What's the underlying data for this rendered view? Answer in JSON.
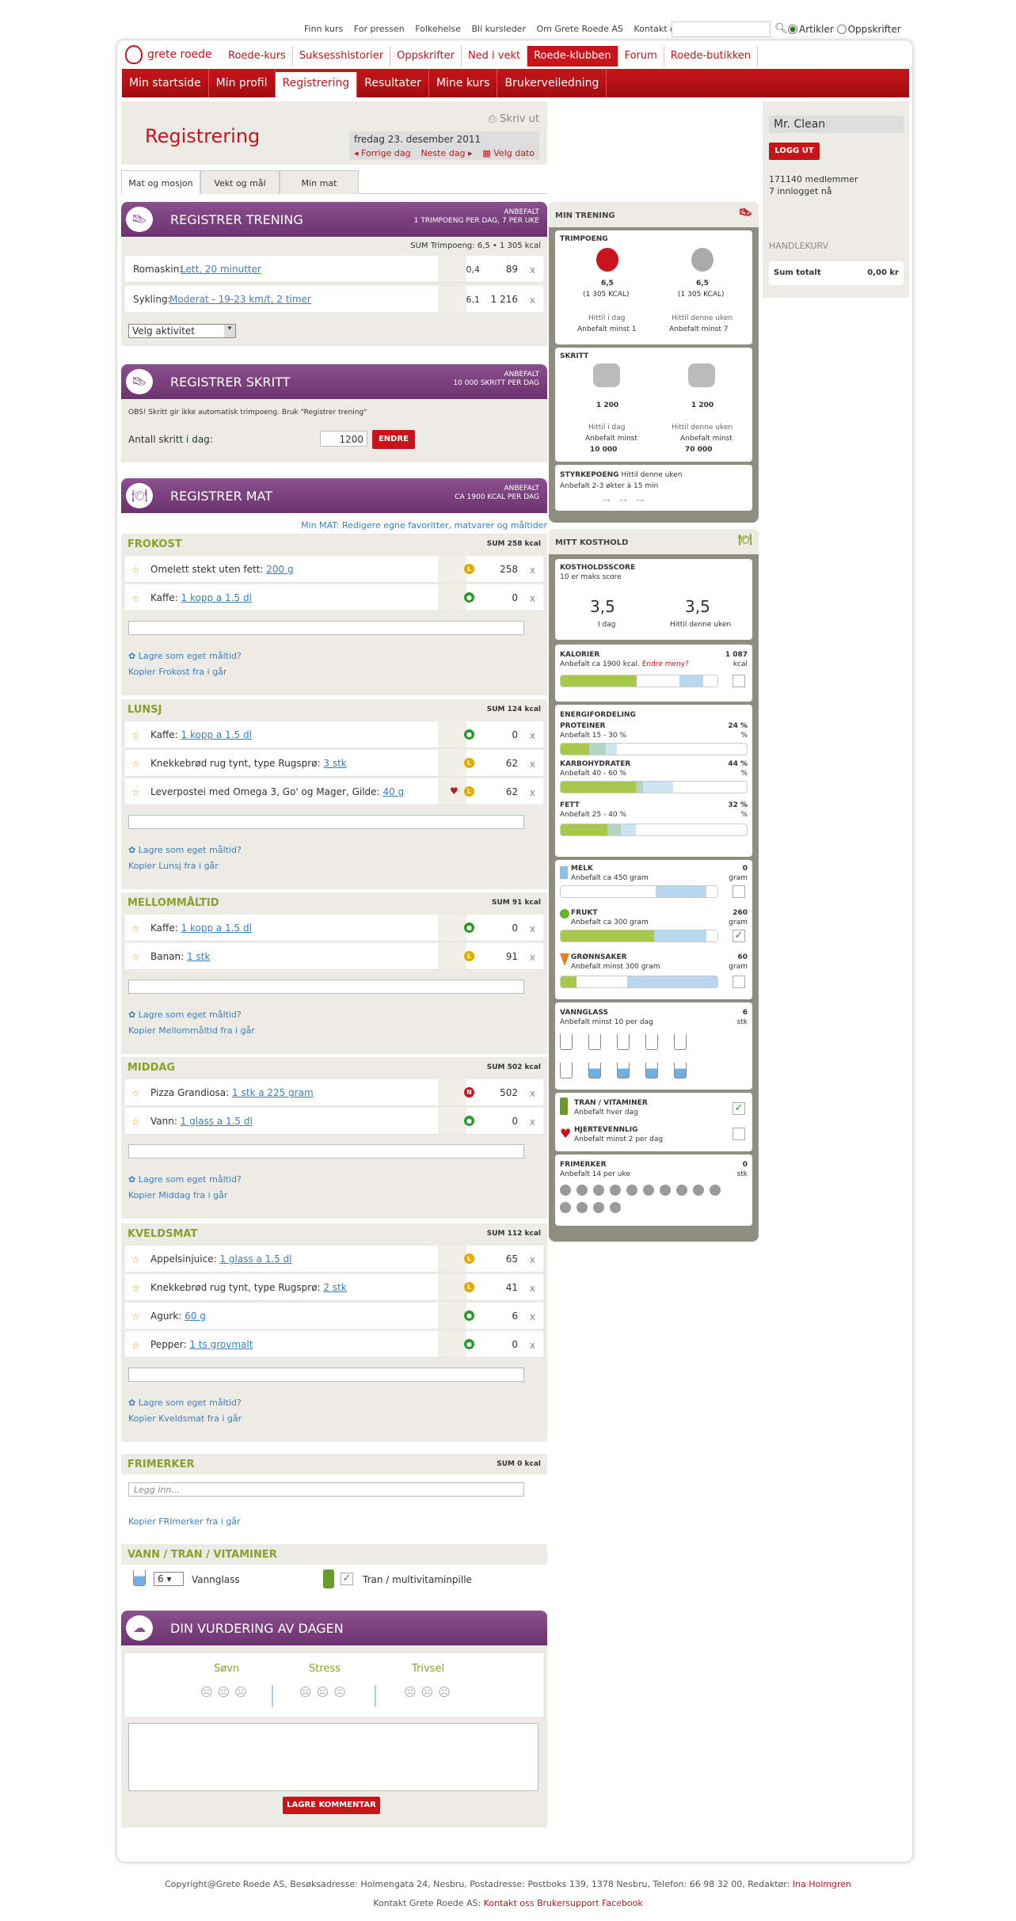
{
  "toplinks": [
    "Finn kurs",
    "For pressen",
    "Folkehelse",
    "Bli kursleder",
    "Om Grete Roede AS",
    "Kontakt oss"
  ],
  "search": {
    "opt1": "Artikler",
    "opt2": "Oppskrifter"
  },
  "logo": "grete roede",
  "nav1": [
    "Roede-kurs",
    "Suksesshistorier",
    "Oppskrifter",
    "Ned i vekt",
    "Roede-klubben",
    "Forum",
    "Roede-butikken"
  ],
  "nav2": [
    "Min startside",
    "Min profil",
    "Registrering",
    "Resultater",
    "Mine kurs",
    "Brukerveiledning"
  ],
  "head": {
    "title": "Registrering",
    "print": "Skriv ut",
    "date": "fredag 23. desember 2011",
    "prev": "Forrige dag",
    "next": "Neste dag",
    "pick": "Velg dato"
  },
  "tabs": [
    "Mat og mosjon",
    "Vekt og mål",
    "Min mat"
  ],
  "trening": {
    "title": "REGISTRER TRENING",
    "r1": "ANBEFALT",
    "r2": "1 TRIMPOENG PER DAG, 7 PER UKE",
    "sum": "SUM Trimpoeng: 6,5 • 1 305 kcal",
    "rows": [
      {
        "n": "Romaskin:",
        "l": "Lett, 20 minutter",
        "v1": "0,4",
        "v2": "89"
      },
      {
        "n": "Sykling:",
        "l": "Moderat - 19-23 km/t, 2 timer",
        "v1": "6,1",
        "v2": "1 216"
      }
    ],
    "select": "Velg aktivitet"
  },
  "skritt": {
    "title": "REGISTRER SKRITT",
    "r1": "ANBEFALT",
    "r2": "10 000 SKRITT PER DAG",
    "obs": "OBS! Skritt gir ikke automatisk trimpoeng. Bruk \"Registrer trening\"",
    "label": "Antall skritt i dag:",
    "value": "1200",
    "btn": "ENDRE"
  },
  "mat": {
    "title": "REGISTRER MAT",
    "r1": "ANBEFALT",
    "r2": "CA 1900 KCAL PER DAG",
    "minmat": "Min MAT: Redigere egne favoritter, matvarer og måltider"
  },
  "meals": [
    {
      "name": "FROKOST",
      "sum": "SUM 258 kcal",
      "rows": [
        {
          "t": "Omelett stekt uten fett:",
          "l": "200 g",
          "v": "258",
          "d": "y"
        },
        {
          "t": "Kaffe:",
          "l": "1 kopp a 1.5 dl",
          "v": "0",
          "d": "g"
        }
      ],
      "save": "Lagre som eget måltid?",
      "copy": "Kopier Frokost fra i går"
    },
    {
      "name": "LUNSJ",
      "sum": "SUM 124 kcal",
      "rows": [
        {
          "t": "Kaffe:",
          "l": "1 kopp a 1.5 dl",
          "v": "0",
          "d": "g"
        },
        {
          "t": "Knekkebrød rug tynt, type Rugsprø:",
          "l": "3 stk",
          "v": "62",
          "d": "y"
        },
        {
          "t": "Leverpostei med Omega 3, Go' og Mager, Gilde:",
          "l": "40 g",
          "v": "62",
          "d": "y"
        }
      ],
      "save": "Lagre som eget måltid?",
      "copy": "Kopier Lunsj fra i går"
    },
    {
      "name": "MELLOMMÅLTID",
      "sum": "SUM 91 kcal",
      "rows": [
        {
          "t": "Kaffe:",
          "l": "1 kopp a 1.5 dl",
          "v": "0",
          "d": "g"
        },
        {
          "t": "Banan:",
          "l": "1 stk",
          "v": "91",
          "d": "y"
        }
      ],
      "save": "Lagre som eget måltid?",
      "copy": "Kopier Mellommåltid fra i går"
    },
    {
      "name": "MIDDAG",
      "sum": "SUM 502 kcal",
      "rows": [
        {
          "t": "Pizza Grandiosa:",
          "l": "1 stk a 225 gram",
          "v": "502",
          "d": "r"
        },
        {
          "t": "Vann:",
          "l": "1 glass a 1.5 dl",
          "v": "0",
          "d": "g"
        }
      ],
      "save": "Lagre som eget måltid?",
      "copy": "Kopier Middag fra i går"
    },
    {
      "name": "KVELDSMAT",
      "sum": "SUM 112 kcal",
      "rows": [
        {
          "t": "Appelsinjuice:",
          "l": "1 glass a 1.5 dl",
          "v": "65",
          "d": "y"
        },
        {
          "t": "Knekkebrød rug tynt, type Rugsprø:",
          "l": "2 stk",
          "v": "41",
          "d": "y"
        },
        {
          "t": "Agurk:",
          "l": "60 g",
          "v": "6",
          "d": "g"
        },
        {
          "t": "Pepper:",
          "l": "1 ts grovmalt",
          "v": "0",
          "d": "g"
        }
      ],
      "save": "Lagre som eget måltid?",
      "copy": "Kopier Kveldsmat fra i går"
    }
  ],
  "frimerker": {
    "name": "FRIMERKER",
    "sum": "SUM 0 kcal",
    "placeholder": "Legg inn...",
    "copy": "Kopier FRImerker fra i går"
  },
  "vann": {
    "name": "VANN / TRAN / VITAMINER",
    "glass": "6",
    "glasslbl": "Vannglass",
    "tran": "Tran / multivitaminpille"
  },
  "vurdering": {
    "title": "DIN VURDERING AV DAGEN",
    "c1": "Søvn",
    "c2": "Stress",
    "c3": "Trivsel",
    "btn": "LAGRE KOMMENTAR"
  },
  "mintrening": {
    "title": "MIN TRENING",
    "trimpoeng": "TRIMPOENG",
    "a1": "6,5",
    "a1k": "(1 305 KCAL)",
    "a2": "6,5",
    "a2k": "(1 305 KCAL)",
    "h1": "Hittil i dag",
    "h2": "Hittil denne uken",
    "r1": "Anbefalt minst 1",
    "r2": "Anbefalt minst 7",
    "skritt": "SKRITT",
    "s1": "1 200",
    "s2": "1 200",
    "sh1": "Hittil i dag",
    "sh2": "Hittil denne uken",
    "sr1": "Anbefalt minst",
    "sr2": "Anbefalt minst",
    "sv1": "10 000",
    "sv2": "70 000",
    "styrke": "STYRKEPOENG",
    "styrke2": "Hittil denne uken",
    "styrke3": "Anbefalt 2-3 økter à 15 min"
  },
  "kosthold": {
    "title": "MITT KOSTHOLD",
    "score": "KOSTHOLDSSCORE",
    "scoresub": "10 er maks score",
    "v1": "3,5",
    "v2": "3,5",
    "l1": "I dag",
    "l2": "Hittil denne uken",
    "kal": "KALORIER",
    "kalv": "1 087",
    "kalu": "kcal",
    "kals": "Anbefalt ca 1900 kcal.",
    "endre": "Endre meny?",
    "ef": "ENERGIFORDELING",
    "prot": "PROTEINER",
    "protv": "24 %",
    "prots": "Anbefalt 15 - 30 %",
    "pct": "%",
    "karb": "KARBOHYDRATER",
    "karbv": "44 %",
    "karbs": "Anbefalt 40 - 60 %",
    "fett": "FETT",
    "fettv": "32 %",
    "fetts": "Anbefalt 25 - 40 %",
    "melk": "MELK",
    "melkv": "0",
    "melks": "Anbefalt ca 450 gram",
    "gram": "gram",
    "frukt": "FRUKT",
    "fruktv": "260",
    "frukts": "Anbefalt ca 300 gram",
    "gront": "GRØNNSAKER",
    "grontv": "60",
    "gronts": "Anbefalt minst 300 gram",
    "vann": "VANNGLASS",
    "vannv": "6",
    "vanns": "Anbefalt minst 10 per dag",
    "stk": "stk",
    "tran": "TRAN / VITAMINER",
    "trans": "Anbefalt hver dag",
    "hjerte": "HJERTEVENNLIG",
    "hjertes": "Anbefalt minst 2 per dag",
    "fri": "FRIMERKER",
    "friv": "0",
    "fris": "Anbefalt 14 per uke"
  },
  "user": {
    "name": "Mr. Clean",
    "logout": "LOGG UT",
    "members": "171140 medlemmer",
    "online": "7 innlogget nå"
  },
  "cart": {
    "title": "HANDLEKURV",
    "sum": "Sum totalt",
    "val": "0,00 kr"
  },
  "footer": {
    "line1": "Copyright@Grete Roede AS, Besøksadresse: Holmengata 24, Nesbru, Postadresse: Postboks 139, 1378 Nesbru, Telefon: 66 98 32 00, Redaktør:",
    "editor": "Ina Holmgren",
    "line2": "Kontakt Grete Roede AS:",
    "links": "Kontakt oss Brukersupport Facebook"
  },
  "colors": {
    "brand": "#c8141a",
    "purple": "#8a4f8e",
    "green": "#8aa02a"
  }
}
